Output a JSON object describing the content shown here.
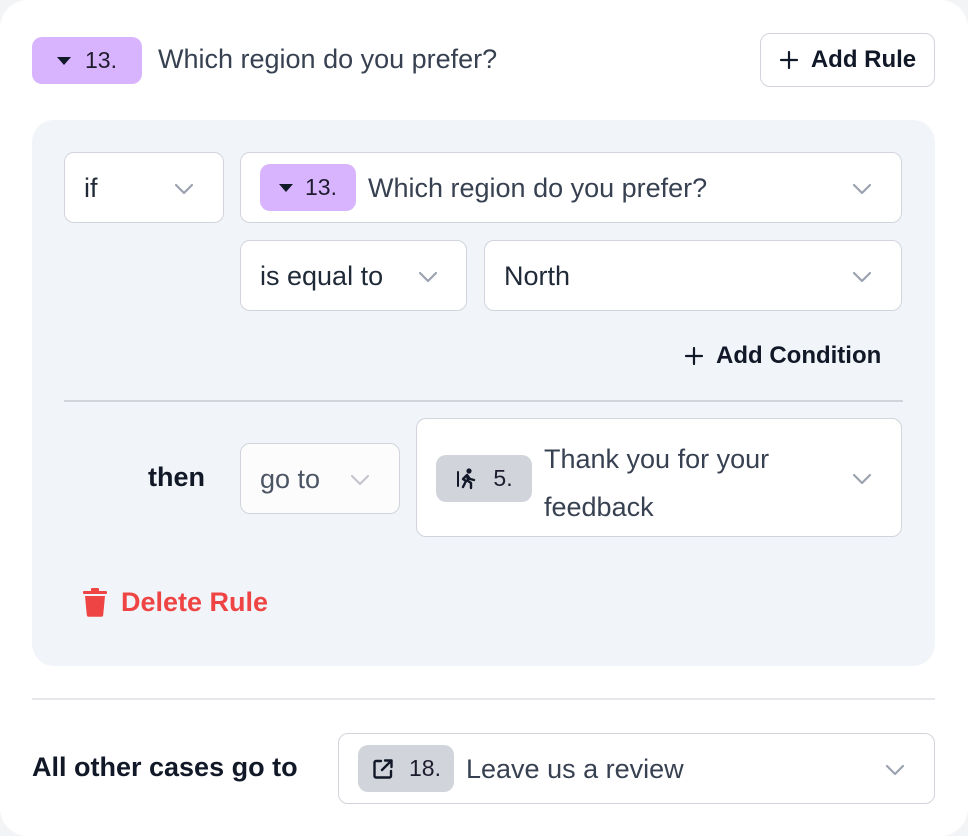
{
  "header": {
    "question_number": "13.",
    "question_title": "Which region do you prefer?",
    "add_rule_label": "Add Rule"
  },
  "rule": {
    "if_label": "if",
    "condition_question_number": "13.",
    "condition_question_title": "Which region do you prefer?",
    "operator": "is equal to",
    "value": "North",
    "add_condition_label": "Add Condition",
    "then_label": "then",
    "action": "go to",
    "target_number": "5.",
    "target_title_line1": "Thank you for your",
    "target_title_line2": "feedback",
    "delete_label": "Delete Rule"
  },
  "fallback": {
    "label": "All other cases go to",
    "target_number": "18.",
    "target_title": "Leave us a review"
  },
  "colors": {
    "accent_purple": "#d8b4fe",
    "danger": "#ef4444",
    "panel_bg": "#f1f4f8"
  }
}
